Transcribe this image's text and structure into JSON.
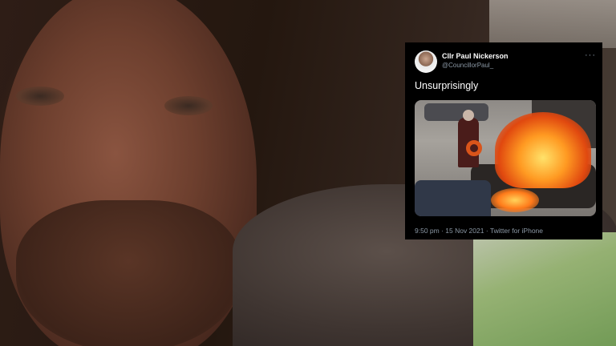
{
  "tweet": {
    "display_name": "Cllr Paul Nickerson",
    "handle": "@CouncillorPaul_",
    "more_icon": "more-icon",
    "text": "Unsurprisingly",
    "meta": "9:50 pm · 15 Nov 2021 · Twitter for iPhone"
  }
}
